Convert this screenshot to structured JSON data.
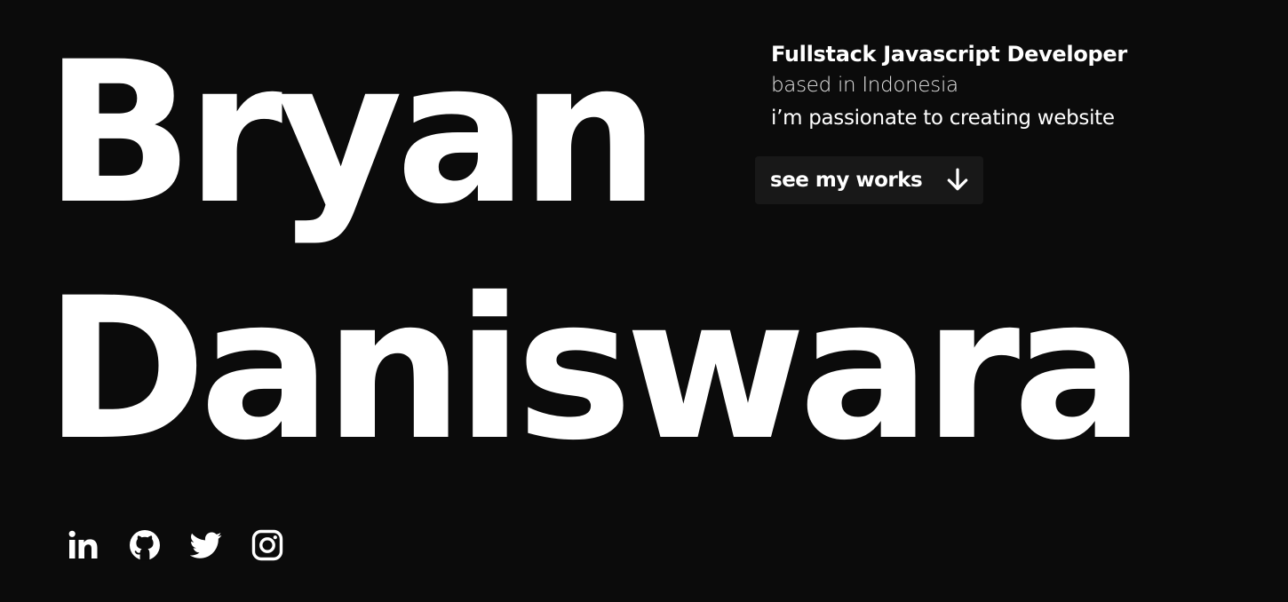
{
  "hero": {
    "first_name": "Bryan",
    "last_name": "Daniswara"
  },
  "intro": {
    "role": "Fullstack Javascript Developer",
    "location": "based in Indonesia",
    "tagline": "i’m passionate to creating website"
  },
  "cta": {
    "label": "see my works",
    "icon": "arrow-down-icon"
  },
  "socials": [
    {
      "name": "LinkedIn",
      "icon": "linkedin-icon"
    },
    {
      "name": "GitHub",
      "icon": "github-icon"
    },
    {
      "name": "Twitter",
      "icon": "twitter-icon"
    },
    {
      "name": "Instagram",
      "icon": "instagram-icon"
    }
  ],
  "colors": {
    "background": "#0b0b0b",
    "text": "#ffffff",
    "button_background": "#181818"
  }
}
